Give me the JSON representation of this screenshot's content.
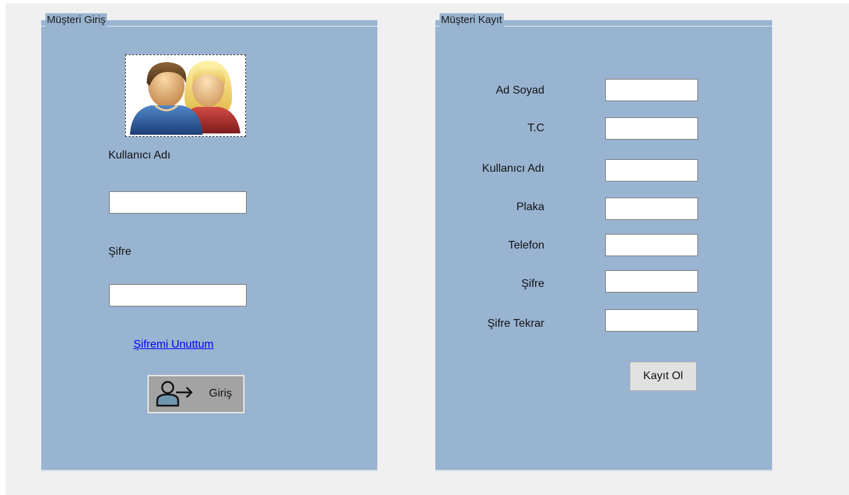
{
  "login": {
    "group_title": "Müşteri Giriş",
    "username_label": "Kullanıcı Adı",
    "username_value": "",
    "password_label": "Şifre",
    "password_value": "",
    "forgot_link": "Şifremi Unuttum",
    "login_button": "Giriş",
    "avatar_icon": "users-icon",
    "button_icon": "user-arrow-icon"
  },
  "register": {
    "group_title": "Müşteri Kayıt",
    "fields": [
      {
        "label": "Ad Soyad",
        "value": ""
      },
      {
        "label": "T.C",
        "value": ""
      },
      {
        "label": "Kullanıcı Adı",
        "value": ""
      },
      {
        "label": "Plaka",
        "value": ""
      },
      {
        "label": "Telefon",
        "value": ""
      },
      {
        "label": "Şifre",
        "value": ""
      },
      {
        "label": "Şifre Tekrar",
        "value": ""
      }
    ],
    "submit_button": "Kayıt Ol"
  },
  "colors": {
    "groupbox_bg": "#99b4d1",
    "form_bg": "#f0f0f0",
    "link": "#0000ff",
    "button_bg": "#a3a3a3"
  }
}
